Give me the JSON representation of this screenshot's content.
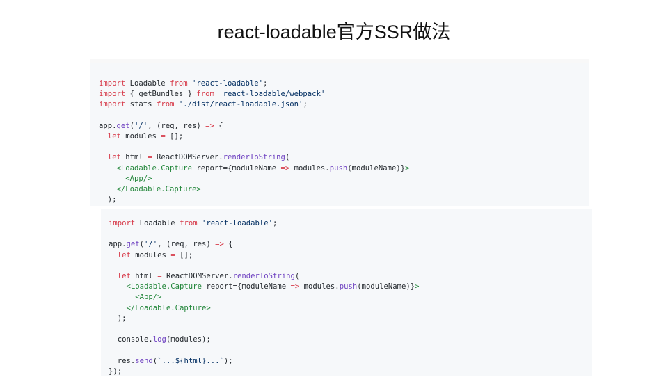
{
  "slide": {
    "title": "react-loadable官方SSR做法"
  },
  "colors": {
    "keyword": "#d73a49",
    "string": "#032f62",
    "function": "#6f42c1",
    "tag": "#22863a",
    "text": "#24292e",
    "panel_bg": "#f6f8fa"
  },
  "code_blocks": [
    {
      "lines": [
        [
          [
            "kw",
            "import"
          ],
          [
            "p",
            " Loadable "
          ],
          [
            "kw",
            "from"
          ],
          [
            "p",
            " "
          ],
          [
            "str",
            "'react-loadable'"
          ],
          [
            "p",
            ";"
          ]
        ],
        [
          [
            "kw",
            "import"
          ],
          [
            "p",
            " { getBundles } "
          ],
          [
            "kw",
            "from"
          ],
          [
            "p",
            " "
          ],
          [
            "str",
            "'react-loadable/webpack'"
          ]
        ],
        [
          [
            "kw",
            "import"
          ],
          [
            "p",
            " stats "
          ],
          [
            "kw",
            "from"
          ],
          [
            "p",
            " "
          ],
          [
            "str",
            "'./dist/react-loadable.json'"
          ],
          [
            "p",
            ";"
          ]
        ],
        [],
        [
          [
            "p",
            "app."
          ],
          [
            "fn",
            "get"
          ],
          [
            "p",
            "("
          ],
          [
            "str",
            "'/'"
          ],
          [
            "p",
            ", (req, res) "
          ],
          [
            "kw",
            "=>"
          ],
          [
            "p",
            " {"
          ]
        ],
        [
          [
            "p",
            "  "
          ],
          [
            "kw",
            "let"
          ],
          [
            "p",
            " modules "
          ],
          [
            "kw",
            "="
          ],
          [
            "p",
            " [];"
          ]
        ],
        [],
        [
          [
            "p",
            "  "
          ],
          [
            "kw",
            "let"
          ],
          [
            "p",
            " html "
          ],
          [
            "kw",
            "="
          ],
          [
            "p",
            " ReactDOMServer."
          ],
          [
            "fn",
            "renderToString"
          ],
          [
            "p",
            "("
          ]
        ],
        [
          [
            "p",
            "    "
          ],
          [
            "tag",
            "<Loadable.Capture"
          ],
          [
            "p",
            " report={moduleName "
          ],
          [
            "kw",
            "=>"
          ],
          [
            "p",
            " modules."
          ],
          [
            "fn",
            "push"
          ],
          [
            "p",
            "(moduleName)}"
          ],
          [
            "tag",
            ">"
          ]
        ],
        [
          [
            "p",
            "      "
          ],
          [
            "tag",
            "<App/>"
          ]
        ],
        [
          [
            "p",
            "    "
          ],
          [
            "tag",
            "</Loadable.Capture>"
          ]
        ],
        [
          [
            "p",
            "  );"
          ]
        ]
      ]
    },
    {
      "lines": [
        [
          [
            "kw",
            "import"
          ],
          [
            "p",
            " Loadable "
          ],
          [
            "kw",
            "from"
          ],
          [
            "p",
            " "
          ],
          [
            "str",
            "'react-loadable'"
          ],
          [
            "p",
            ";"
          ]
        ],
        [],
        [
          [
            "p",
            "app."
          ],
          [
            "fn",
            "get"
          ],
          [
            "p",
            "("
          ],
          [
            "str",
            "'/'"
          ],
          [
            "p",
            ", (req, res) "
          ],
          [
            "kw",
            "=>"
          ],
          [
            "p",
            " {"
          ]
        ],
        [
          [
            "p",
            "  "
          ],
          [
            "kw",
            "let"
          ],
          [
            "p",
            " modules "
          ],
          [
            "kw",
            "="
          ],
          [
            "p",
            " [];"
          ]
        ],
        [],
        [
          [
            "p",
            "  "
          ],
          [
            "kw",
            "let"
          ],
          [
            "p",
            " html "
          ],
          [
            "kw",
            "="
          ],
          [
            "p",
            " ReactDOMServer."
          ],
          [
            "fn",
            "renderToString"
          ],
          [
            "p",
            "("
          ]
        ],
        [
          [
            "p",
            "    "
          ],
          [
            "tag",
            "<Loadable.Capture"
          ],
          [
            "p",
            " report={moduleName "
          ],
          [
            "kw",
            "=>"
          ],
          [
            "p",
            " modules."
          ],
          [
            "fn",
            "push"
          ],
          [
            "p",
            "(moduleName)}"
          ],
          [
            "tag",
            ">"
          ]
        ],
        [
          [
            "p",
            "      "
          ],
          [
            "tag",
            "<App/>"
          ]
        ],
        [
          [
            "p",
            "    "
          ],
          [
            "tag",
            "</Loadable.Capture>"
          ]
        ],
        [
          [
            "p",
            "  );"
          ]
        ],
        [],
        [
          [
            "p",
            "  console."
          ],
          [
            "fn",
            "log"
          ],
          [
            "p",
            "(modules);"
          ]
        ],
        [],
        [
          [
            "p",
            "  res."
          ],
          [
            "fn",
            "send"
          ],
          [
            "p",
            "("
          ],
          [
            "str",
            "`...${html}...`"
          ],
          [
            "p",
            ");"
          ]
        ],
        [
          [
            "p",
            "});"
          ]
        ]
      ]
    }
  ]
}
